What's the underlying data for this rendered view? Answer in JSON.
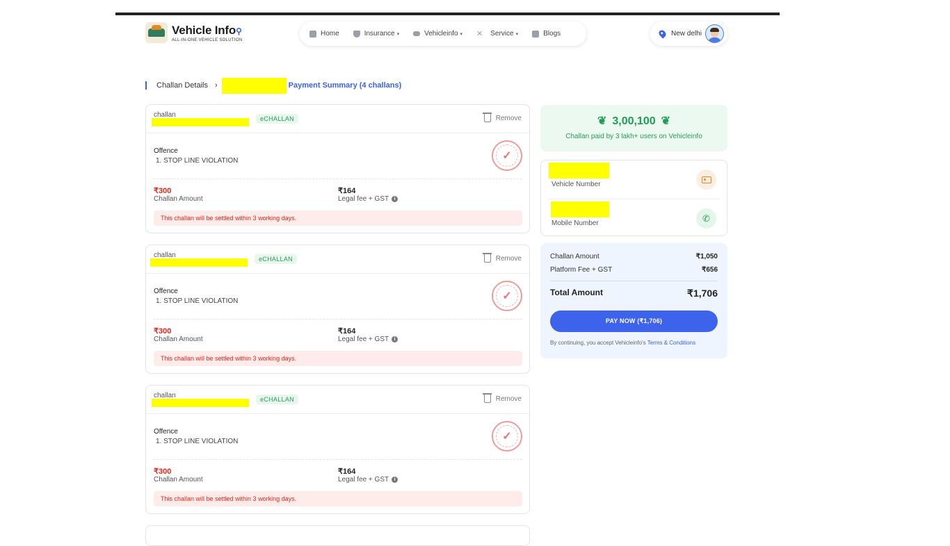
{
  "header": {
    "logo_title": "Vehicle Inf",
    "logo_title_end": "o",
    "logo_tagline": "ALL-IN-ONE VEHICLE SOLUTION",
    "nav": [
      {
        "label": "Home",
        "icon": "home-icon",
        "dropdown": false
      },
      {
        "label": "Insurance",
        "icon": "shield-icon",
        "dropdown": true
      },
      {
        "label": "Vehicleinfo",
        "icon": "car-icon",
        "dropdown": true
      },
      {
        "label": "Service",
        "icon": "tools-icon",
        "dropdown": true
      },
      {
        "label": "Blogs",
        "icon": "blog-icon",
        "dropdown": false
      }
    ],
    "location": "New delhi"
  },
  "breadcrumb": {
    "step1": "Challan Details",
    "step2": "Payment Summary (4 challans)"
  },
  "challans": [
    {
      "label": "challan",
      "badge": "eCHALLAN",
      "remove": "Remove",
      "offence_title": "Offence",
      "offence_item": "1. STOP LINE VIOLATION",
      "amount": "₹300",
      "amount_label": "Challan Amount",
      "fee": "₹164",
      "fee_label": "Legal fee + GST",
      "note": "This challan will be settled  within 3 working days."
    },
    {
      "label": "challan",
      "badge": "eCHALLAN",
      "remove": "Remove",
      "offence_title": "Offence",
      "offence_item": "1. STOP LINE VIOLATION",
      "amount": "₹300",
      "amount_label": "Challan Amount",
      "fee": "₹164",
      "fee_label": "Legal fee + GST",
      "note": "This challan will be settled  within 3 working days."
    },
    {
      "label": "challan",
      "badge": "eCHALLAN",
      "remove": "Remove",
      "offence_title": "Offence",
      "offence_item": "1. STOP LINE VIOLATION",
      "amount": "₹300",
      "amount_label": "Challan Amount",
      "fee": "₹164",
      "fee_label": "Legal fee + GST",
      "note": "This challan will be settled  within 3 working days."
    }
  ],
  "promo": {
    "count": "3,00,100",
    "subtitle": "Challan paid by 3 lakh+ users on Vehicleinfo"
  },
  "vehicle_box": {
    "vehicle_label": "Vehicle Number",
    "mobile_label": "Mobile Number"
  },
  "summary": {
    "challan_amount_label": "Challan Amount",
    "challan_amount": "₹1,050",
    "platform_fee_label": "Platform Fee + GST",
    "platform_fee": "₹656",
    "total_label": "Total Amount",
    "total": "₹1,706",
    "pay_button": "PAY NOW (₹1,706)",
    "terms_prefix": "By continuing, you accept Vehicleinfo's ",
    "terms_link": "Terms & Conditions"
  },
  "colors": {
    "accent": "#3d63ec",
    "amount_red": "#e0261c",
    "promo_green": "#1f9d55",
    "redaction": "#ffff00"
  }
}
